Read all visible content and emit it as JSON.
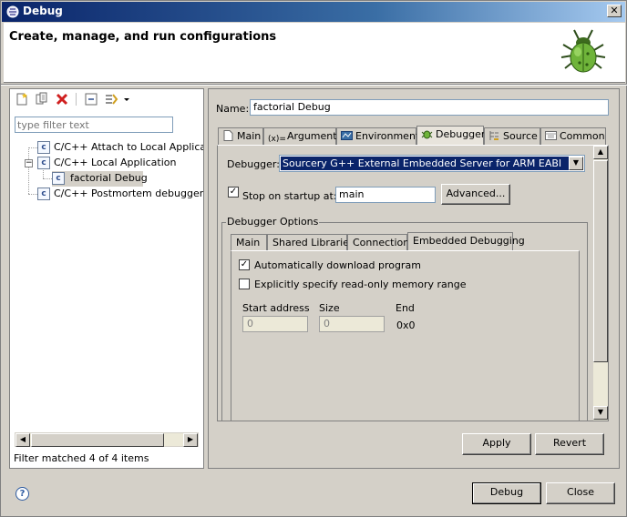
{
  "window": {
    "title": "Debug"
  },
  "header": {
    "title": "Create, manage, and run configurations"
  },
  "left": {
    "filter_placeholder": "type filter text",
    "tree": [
      {
        "label": "C/C++ Attach to Local Application"
      },
      {
        "label": "C/C++ Local Application"
      },
      {
        "label": "factorial Debug"
      },
      {
        "label": "C/C++ Postmortem debugger"
      }
    ],
    "status": "Filter matched 4 of 4 items"
  },
  "config": {
    "name_label": "Name:",
    "name_value": "factorial Debug",
    "tabs": [
      "Main",
      "Arguments",
      "Environment",
      "Debugger",
      "Source",
      "Common"
    ],
    "active_tab": "Debugger",
    "debugger_label": "Debugger:",
    "debugger_value": "Sourcery G++ External Embedded Server for ARM EABI",
    "stop_label": "Stop on startup at:",
    "stop_checked": true,
    "stop_value": "main",
    "advanced_label": "Advanced...",
    "options_label": "Debugger Options",
    "inner_tabs": [
      "Main",
      "Shared Libraries",
      "Connection",
      "Embedded Debugging"
    ],
    "inner_active": "Embedded Debugging",
    "auto_download_label": "Automatically download program",
    "auto_download_checked": true,
    "readonly_label": "Explicitly specify read-only memory range",
    "readonly_checked": false,
    "start_label": "Start address",
    "size_label": "Size",
    "end_label": "End",
    "start_value": "0",
    "size_value": "0",
    "end_value": "0x0"
  },
  "buttons": {
    "apply": "Apply",
    "revert": "Revert",
    "debug": "Debug",
    "close": "Close",
    "help": "?"
  }
}
